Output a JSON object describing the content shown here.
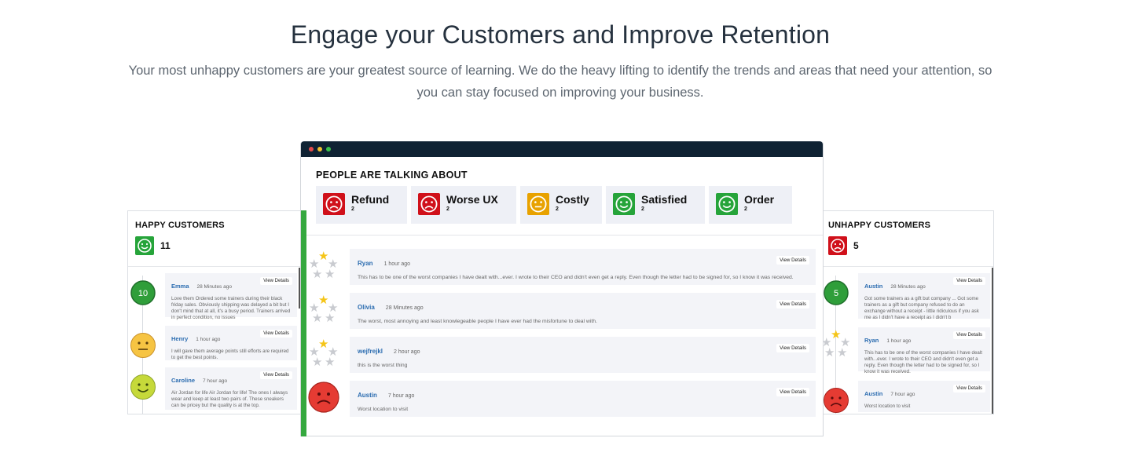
{
  "hero": {
    "title": "Engage your Customers and Improve Retention",
    "subtitle": "Your most unhappy customers are your greatest source of learning. We do the heavy lifting to identify the trends and areas that need your attention, so you can stay focused on improving your business."
  },
  "colors": {
    "red": "#d0101a",
    "green": "#26a43a",
    "yellow": "#e8a200",
    "dark_bar": "#0f2233",
    "link_blue": "#2b6cb0"
  },
  "window": {
    "title": "PEOPLE ARE TALKING ABOUT",
    "dots": [
      "#e34a4a",
      "#f2c230",
      "#39c14b"
    ],
    "topics": [
      {
        "label": "Refund",
        "count": "2",
        "mood": "unhappy-face-icon",
        "color": "red"
      },
      {
        "label": "Worse UX",
        "count": "2",
        "mood": "unhappy-face-icon",
        "color": "red"
      },
      {
        "label": "Costly",
        "count": "2",
        "mood": "neutral-face-icon",
        "color": "yellow"
      },
      {
        "label": "Satisfied",
        "count": "2",
        "mood": "happy-face-icon",
        "color": "green"
      },
      {
        "label": "Order",
        "count": "2",
        "mood": "happy-face-icon",
        "color": "green"
      }
    ],
    "reviews": [
      {
        "name": "Ryan",
        "time": "1 hour ago",
        "text": "This has to be one of the worst companies I have dealt with...ever. I wrote to their CEO and didn't even get a reply. Even though the letter had to be signed for, so I know it was received.",
        "view": "View Details",
        "rating": 1,
        "rating_max": 5
      },
      {
        "name": "Olivia",
        "time": "28 Minutes ago",
        "text": "The worst, most annoying and least knowlegeable people I have ever had the misfortune to deal with.",
        "view": "View Details",
        "rating": 1,
        "rating_max": 5
      },
      {
        "name": "wejfrejkl",
        "time": "2 hour ago",
        "text": "this is the worst thing",
        "view": "View Details",
        "rating": 1,
        "rating_max": 5
      },
      {
        "name": "Austin",
        "time": "7 hour ago",
        "text": "Worst location to visit",
        "view": "View Details",
        "marker": "red-sad-face-icon"
      }
    ]
  },
  "happy": {
    "title": "HAPPY CUSTOMERS",
    "count": "11",
    "items": [
      {
        "name": "Emma",
        "time": "28 Minutes ago",
        "text": "Love them Ordered some trainers during their black friday sales. Obviously shipping was delayed a bit but I don't mind that at all, it's a busy period. Trainers arrived in perfect condition, no issues",
        "view": "View Details",
        "badge": "10"
      },
      {
        "name": "Henry",
        "time": "1 hour ago",
        "text": "I will gave them average points still efforts are required to get the best points.",
        "view": "View Details",
        "marker": "neutral-face-icon"
      },
      {
        "name": "Caroline",
        "time": "7 hour ago",
        "text": "Air Jordan for life Air Jordan for life! The ones I always wear and keep at least two pairs of. These sneakers can be pricey but the quality is at the top.",
        "view": "View Details",
        "marker": "smile-face-icon"
      }
    ]
  },
  "unhappy": {
    "title": "UNHAPPY CUSTOMERS",
    "count": "5",
    "items": [
      {
        "name": "Austin",
        "time": "28 Minutes ago",
        "text": "Got some trainers as a gift but company ... Got some trainers as a gift but company refused to do an exchange without a receipt - little ridiculous if you ask me as I didn't have a receipt as I didn't b",
        "view": "View Details",
        "badge": "5"
      },
      {
        "name": "Ryan",
        "time": "1 hour ago",
        "text": "This has to be one of the worst companies I have dealt with...ever. I wrote to their CEO and didn't even get a reply. Even though the letter had to be signed for, so I know it was received.",
        "view": "View Details",
        "rating": 1,
        "rating_max": 5
      },
      {
        "name": "Austin",
        "time": "7 hour ago",
        "text": "Worst location to visit",
        "view": "View Details",
        "marker": "red-sad-face-icon"
      }
    ]
  }
}
